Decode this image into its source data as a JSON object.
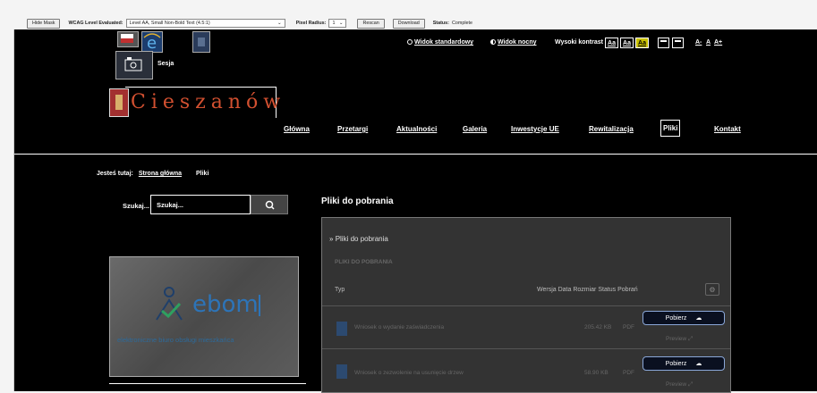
{
  "toolbar": {
    "hide_mask": "Hide Mask",
    "wcag_label": "WCAG Level Evaluated:",
    "wcag_value": "Level AA, Small Non-Bold Text (4.5:1)",
    "pixel_label": "Pixel Radius:",
    "pixel_value": "1",
    "rescan": "Rescan",
    "download": "Download",
    "status_label": "Status:",
    "status_value": "Complete"
  },
  "header": {
    "sesja": "Sesja",
    "logo_text": "Cieszanów",
    "view_standard": "Widok standardowy",
    "view_night": "Widok nocny",
    "high_contrast": "Wysoki kontrast",
    "contrast_options": [
      "Aa",
      "Aa",
      "Aa"
    ],
    "font_sizes": [
      "A-",
      "A",
      "A+"
    ]
  },
  "nav": {
    "items": [
      "Główna",
      "Przetargi",
      "Aktualności",
      "Galeria",
      "Inwestycje UE",
      "Rewitalizacja",
      "Pliki",
      "Kontakt"
    ],
    "active": "Pliki"
  },
  "breadcrumb": {
    "label": "Jesteś tutaj:",
    "home": "Strona główna",
    "current": "Pliki"
  },
  "search": {
    "label": "Szukaj...",
    "value": "Szukaj..."
  },
  "ebom": {
    "title": "ebom",
    "subtitle": "elektroniczne biuro obsługi mieszkańca"
  },
  "downloads": {
    "heading": "Pliki do pobrania",
    "panel_title": "Pliki do pobrania",
    "section_title": "PLIKI DO POBRANIA",
    "columns": {
      "type": "Typ",
      "meta": "Wersja Data Rozmiar Status Pobrań"
    },
    "files": [
      {
        "name": "Wniosek o wydanie zaświadczenia",
        "size": "205.42 KB",
        "ext": "PDF",
        "download": "Pobierz",
        "preview": "Preview"
      },
      {
        "name": "Wniosek o zezwolenie na usunięcie drzew",
        "size": "58.90 KB",
        "ext": "PDF",
        "download": "Pobierz",
        "preview": "Preview"
      }
    ]
  }
}
